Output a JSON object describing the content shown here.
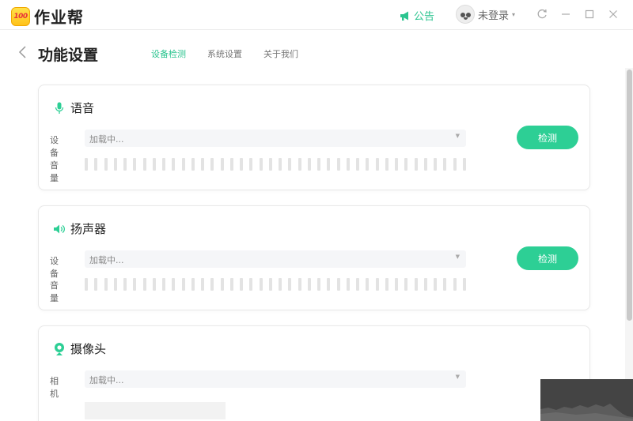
{
  "app": {
    "logo_badge": "100",
    "name": "作业帮"
  },
  "header": {
    "notice_label": "公告",
    "user_label": "未登录"
  },
  "page": {
    "title": "功能设置",
    "tabs": [
      {
        "label": "设备检测",
        "active": true
      },
      {
        "label": "系统设置",
        "active": false
      },
      {
        "label": "关于我们",
        "active": false
      }
    ]
  },
  "sections": {
    "mic": {
      "title": "语音",
      "device_label": "设 备",
      "device_value": "加载中...",
      "volume_label": "音 量",
      "button": "检测"
    },
    "speaker": {
      "title": "扬声器",
      "device_label": "设 备",
      "device_value": "加载中...",
      "volume_label": "音 量",
      "button": "检测"
    },
    "camera": {
      "title": "摄像头",
      "device_label": "相 机",
      "device_value": "加载中..."
    }
  },
  "colors": {
    "accent": "#2dcf95",
    "accent_text": "#2bc48f"
  }
}
